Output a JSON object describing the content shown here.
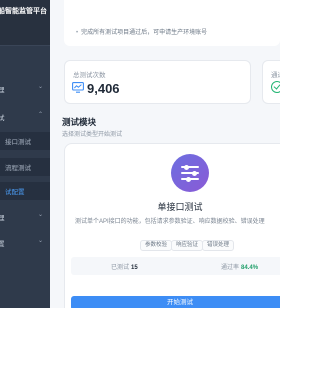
{
  "sidebar": {
    "brand": "船智能监管平台",
    "items": [
      {
        "label": "理",
        "expanded": true
      },
      {
        "label": "试",
        "expanded": true
      },
      {
        "label": "接口测试"
      },
      {
        "label": "流程测试"
      },
      {
        "label": "试配置",
        "active": true
      },
      {
        "label": "理",
        "expanded": false
      },
      {
        "label": "置",
        "expanded": false
      }
    ]
  },
  "notice": {
    "text": "完成所有测试项目通过后，可申请生产环境账号"
  },
  "stats": {
    "total_label": "总测试次数",
    "total_value": "9,406",
    "pass_label": "通过"
  },
  "section": {
    "title": "测试模块",
    "subtitle": "选择测试类型开始测试"
  },
  "module": {
    "icon": "sliders-icon",
    "title": "单接口测试",
    "description": "测试单个API接口的功能，包括请求参数验证、响应数据校验、错误处理",
    "tags": [
      "参数校验",
      "响应验证",
      "错误处理"
    ],
    "tested_label": "已测试",
    "tested_value": "15",
    "rate_label": "通过率",
    "rate_value": "84.4%",
    "button_label": "开始测试"
  },
  "colors": {
    "sidebar_bg": "#2f3a4b",
    "accent": "#3d8df5",
    "success": "#22a06b",
    "icon_gradient_start": "#6c6fe0",
    "icon_gradient_end": "#8a5ad6"
  }
}
